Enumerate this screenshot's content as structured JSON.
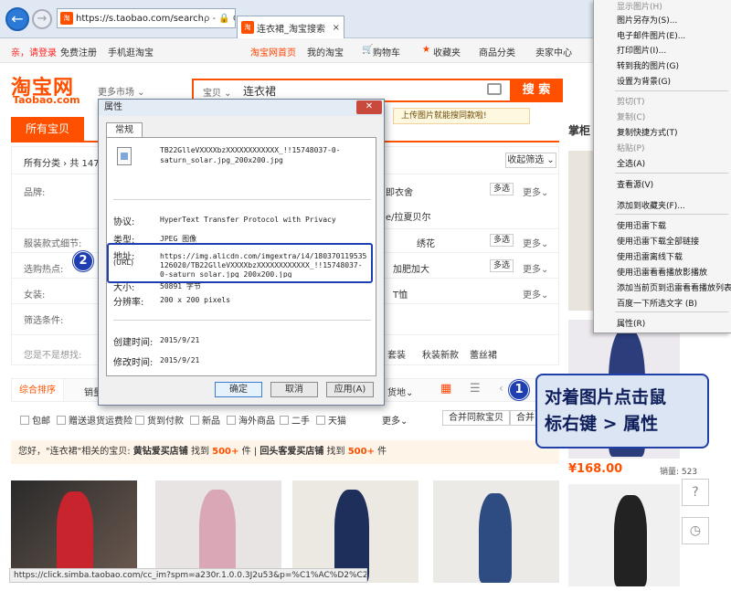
{
  "browser": {
    "back_icon": "back-arrow-icon",
    "forward_icon": "forward-arrow-icon",
    "address": "https://s.taobao.com/search",
    "address_icons": "ρ - 🔒 C",
    "favicon_text": "淘",
    "tab_title": "连衣裙_淘宝搜索",
    "tab_close": "×"
  },
  "topbar": {
    "greeting": "亲，请登录",
    "register": "免费注册",
    "mobile": "手机逛淘宝",
    "home": "淘宝网首页",
    "my_taobao": "我的淘宝",
    "cart": "购物车",
    "favorites": "收藏夹",
    "categories": "商品分类",
    "seller": "卖家中心"
  },
  "header": {
    "logo": "淘宝网",
    "logo_sub": "Taobao.com",
    "more_market": "更多市场 ⌄",
    "search_category": "宝贝 ⌄",
    "search_query": "连衣裙",
    "search_button": "搜 索",
    "upload_tip": "上传图片就能搜同款啦!"
  },
  "tabs": {
    "all": "所有宝贝"
  },
  "filters": {
    "breadcrumb": "所有分类 › 共 1472",
    "collapse": "收起筛选 ⌄",
    "rows": [
      {
        "label": "品牌:",
        "value": "即衣舍",
        "value2": "e/拉夏贝尔"
      },
      {
        "label": "服装款式细节:",
        "value": "绣花"
      },
      {
        "label": "选购热点:",
        "value": "加肥加大"
      },
      {
        "label": "女装:",
        "value": "T恤"
      },
      {
        "label": "筛选条件:",
        "value": ""
      },
      {
        "label": "您是不是想找:",
        "value": "套装",
        "value2": "秋装新款",
        "value3": "蕾丝裙"
      }
    ],
    "multi": "多选",
    "more": "更多⌄"
  },
  "sortbar": {
    "active": "综合排序",
    "next": "销量",
    "location": "货地⌄"
  },
  "checkboxes": [
    "包邮",
    "赠送退货运费险",
    "货到付款",
    "新品",
    "海外商品",
    "二手",
    "天猫"
  ],
  "checkbar": {
    "more": "更多⌄",
    "same_style": "合并同款宝贝",
    "same_style2": "合并"
  },
  "hint": {
    "prefix": "您好，\"连衣裙\"相关的宝贝:",
    "brand": "黄钻爱买店铺",
    "found1": "找到",
    "count1": "500+",
    "unit1": "件",
    "sep": "|",
    "repeat": "回头客爱买店铺",
    "found2": "找到",
    "count2": "500+",
    "unit2": "件"
  },
  "right": {
    "cabinet": "掌柜",
    "price": "¥168.00",
    "sales": "销量: 523",
    "help_icon": "?",
    "history_icon": "◷"
  },
  "status_bar": "https://click.simba.taobao.com/cc_im?spm=a230r.1.0.0.3J2u53&p=%C1%AC%D2%C2...",
  "context_menu": {
    "items": [
      {
        "label": "显示图片(H)",
        "disabled": true
      },
      {
        "label": "图片另存为(S)...",
        "disabled": false
      },
      {
        "label": "电子邮件图片(E)...",
        "disabled": false
      },
      {
        "label": "打印图片(I)...",
        "disabled": false
      },
      {
        "label": "转到我的图片(G)",
        "disabled": false
      },
      {
        "label": "设置为背景(G)",
        "disabled": false
      },
      {
        "label": "剪切(T)",
        "disabled": true
      },
      {
        "label": "复制(C)",
        "disabled": true
      },
      {
        "label": "复制快捷方式(T)",
        "disabled": false
      },
      {
        "label": "粘贴(P)",
        "disabled": true
      },
      {
        "label": "全选(A)",
        "disabled": false
      },
      {
        "label": "查看源(V)",
        "disabled": false
      },
      {
        "label": "添加到收藏夹(F)...",
        "disabled": false
      },
      {
        "label": "使用迅雷下载",
        "disabled": false
      },
      {
        "label": "使用迅雷下载全部链接",
        "disabled": false
      },
      {
        "label": "使用迅雷离线下载",
        "disabled": false
      },
      {
        "label": "使用迅雷看看播放影播放",
        "disabled": false
      },
      {
        "label": "添加当前页到迅雷看看播放列表",
        "disabled": false
      },
      {
        "label": "百度一下所选文字 (B)",
        "disabled": false
      },
      {
        "label": "属性(R)",
        "disabled": false
      }
    ]
  },
  "dialog": {
    "title": "属性",
    "close": "✕",
    "tab": "常规",
    "filename_line1": "TB22GlleVXXXXbzXXXXXXXXXXXX_!!15748037-0-",
    "filename_line2": "saturn_solar.jpg_200x200.jpg",
    "protocol_label": "协议:",
    "protocol_value": "HyperText Transfer Protocol with Privacy",
    "type_label": "类型:",
    "type_value": "JPEG 图像",
    "address_label": "地址:",
    "address_label2": "(URL)",
    "address_line1": "https://img.alicdn.com/imgextra/i4/180370119535",
    "address_line2": "126020/TB22GlleVXXXXbzXXXXXXXXXXXX_!!15748037-",
    "address_line3": "0-saturn_solar.jpg_200x200.jpg",
    "size_label": "大小:",
    "size_value": "50891 字节",
    "resolution_label": "分辨率:",
    "resolution_value": "200 x 200 pixels",
    "created_label": "创建时间:",
    "created_value": "2015/9/21",
    "modified_label": "修改时间:",
    "modified_value": "2015/9/21",
    "ok": "确定",
    "cancel": "取消",
    "apply": "应用(A)"
  },
  "annotations": {
    "badge1": "1",
    "badge2": "2",
    "callout_line1": "对着图片点击鼠",
    "callout_line2": "标右键 > 属性"
  }
}
